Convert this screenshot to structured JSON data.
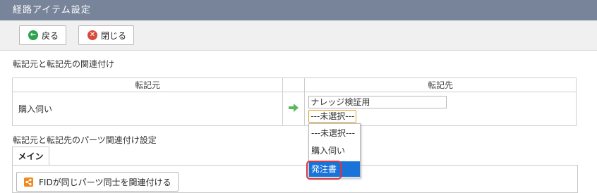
{
  "window": {
    "title": "経路アイテム設定"
  },
  "toolbar": {
    "back_label": "戻る",
    "close_label": "閉じる"
  },
  "mapping": {
    "section_label": "転記元と転記先の関連付け",
    "header_source": "転記元",
    "header_target": "転記先",
    "source_value": "購入伺い",
    "target_input": "ナレッジ検証用",
    "target_select": "---未選択---"
  },
  "dropdown": {
    "options": [
      "---未選択---",
      "購入伺い",
      "発注書"
    ],
    "highlighted": "発注書"
  },
  "parts": {
    "section_label": "転記元と転記先のパーツ関連付け設定",
    "tab_main": "メイン",
    "link_button": "FIDが同じパーツ同士を関連付ける"
  },
  "colors": {
    "titlebar": "#78849a",
    "selection": "#1a73d9",
    "highlight_border": "#d43a44",
    "arrow": "#5cb85c"
  }
}
